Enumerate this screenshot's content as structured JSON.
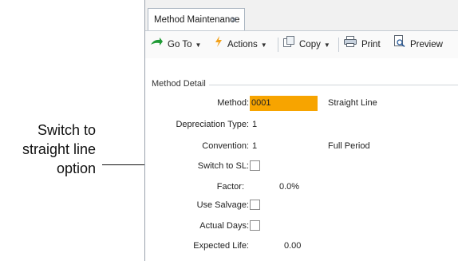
{
  "callout": {
    "text": "Switch to straight line option"
  },
  "tab": {
    "title": "Method Maintenance",
    "close": "✕"
  },
  "toolbar": {
    "goto_label": "Go To",
    "actions_label": "Actions",
    "copy_label": "Copy",
    "print_label": "Print",
    "preview_label": "Preview"
  },
  "section": {
    "title": "Method Detail"
  },
  "fields": {
    "method_label": "Method:",
    "method_value": "0001",
    "method_desc": "Straight Line",
    "dep_type_label": "Depreciation Type:",
    "dep_type_value": "1",
    "convention_label": "Convention:",
    "convention_value": "1",
    "convention_desc": "Full Period",
    "switch_label": "Switch to SL:",
    "factor_label": "Factor:",
    "factor_value": "0.0%",
    "salvage_label": "Use Salvage:",
    "actual_days_label": "Actual Days:",
    "expected_life_label": "Expected Life:",
    "expected_life_value": "0.00"
  },
  "colors": {
    "highlight": "#f7a400"
  }
}
